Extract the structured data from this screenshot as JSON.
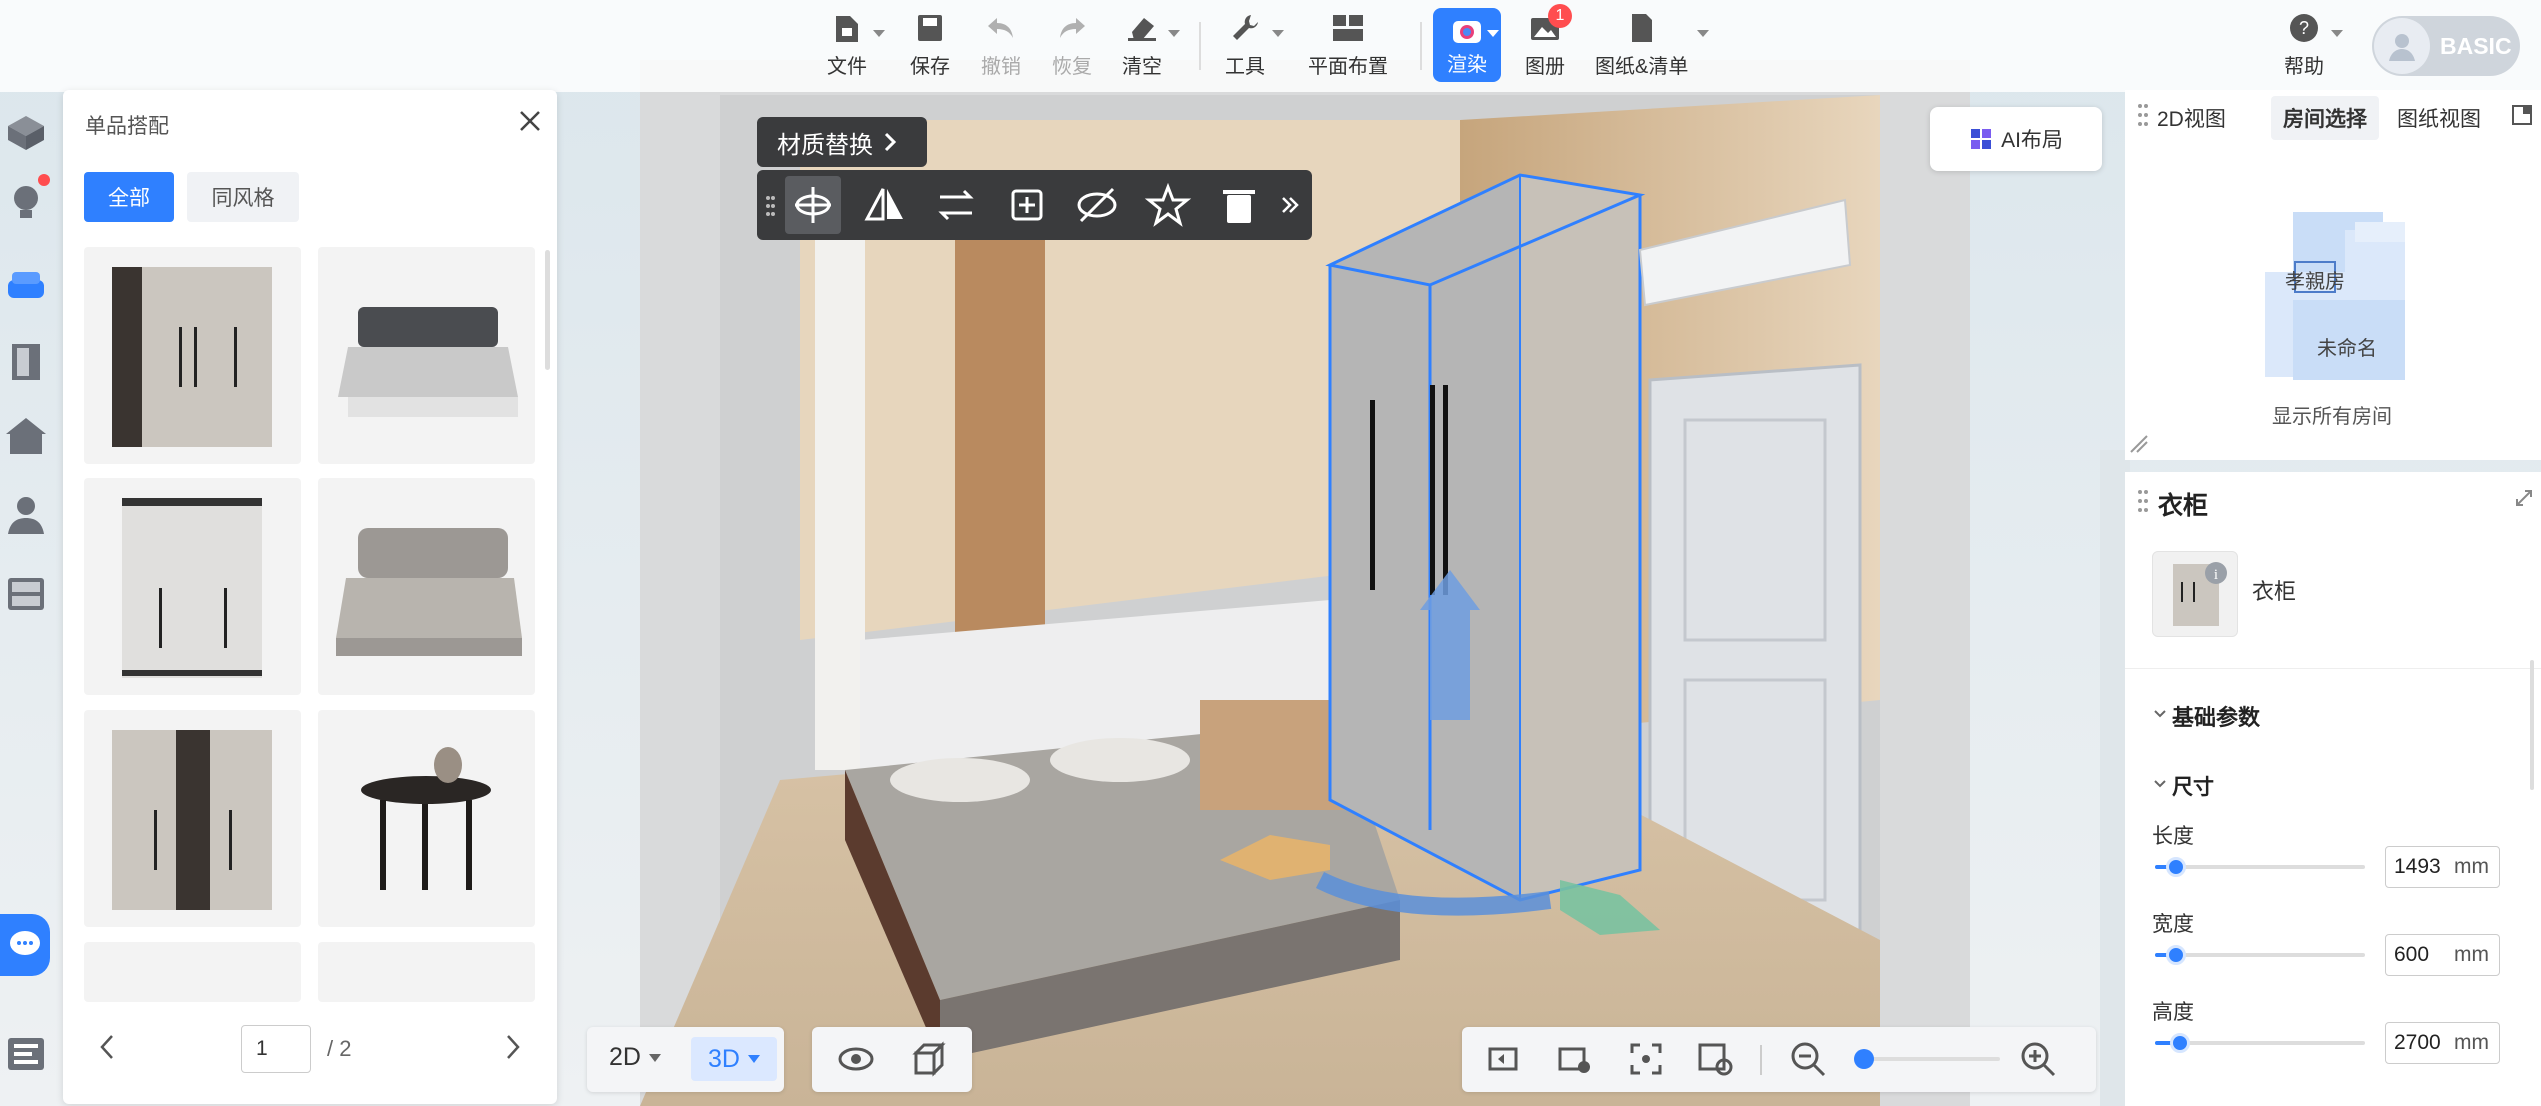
{
  "toolbar": {
    "file": "文件",
    "save": "保存",
    "undo": "撤销",
    "redo": "恢复",
    "clear": "清空",
    "tools": "工具",
    "floor_plan": "平面布置",
    "render": "渲染",
    "album": "图册",
    "album_badge": "1",
    "drawings_list": "图纸&清单",
    "help": "帮助",
    "plan_label": "BASIC"
  },
  "left_panel": {
    "title": "单品搭配",
    "tabs": [
      "全部",
      "同风格"
    ],
    "page_current": "1",
    "page_total": "/ 2"
  },
  "viewport": {
    "material_replace": "材质替换",
    "ai_layout": "AI布局",
    "view_2d": "2D",
    "view_3d": "3D"
  },
  "right_panel": {
    "view_tabs": [
      "2D视图",
      "房间选择",
      "图纸视图"
    ],
    "room_labels": [
      "孝親房",
      "未命名"
    ],
    "show_all_rooms": "显示所有房间",
    "object_title": "衣柜",
    "object_name": "衣柜",
    "section_basic": "基础参数",
    "section_size": "尺寸",
    "params": [
      {
        "label": "长度",
        "value": "1493",
        "unit": "mm",
        "level": 0.1
      },
      {
        "label": "宽度",
        "value": "600",
        "unit": "mm",
        "level": 0.1
      },
      {
        "label": "高度",
        "value": "2700",
        "unit": "mm",
        "level": 0.12
      }
    ]
  },
  "colors": {
    "accent": "#2f80ff",
    "dark_toolbar": "#3a3b3d",
    "badge": "#ff4d4f"
  }
}
